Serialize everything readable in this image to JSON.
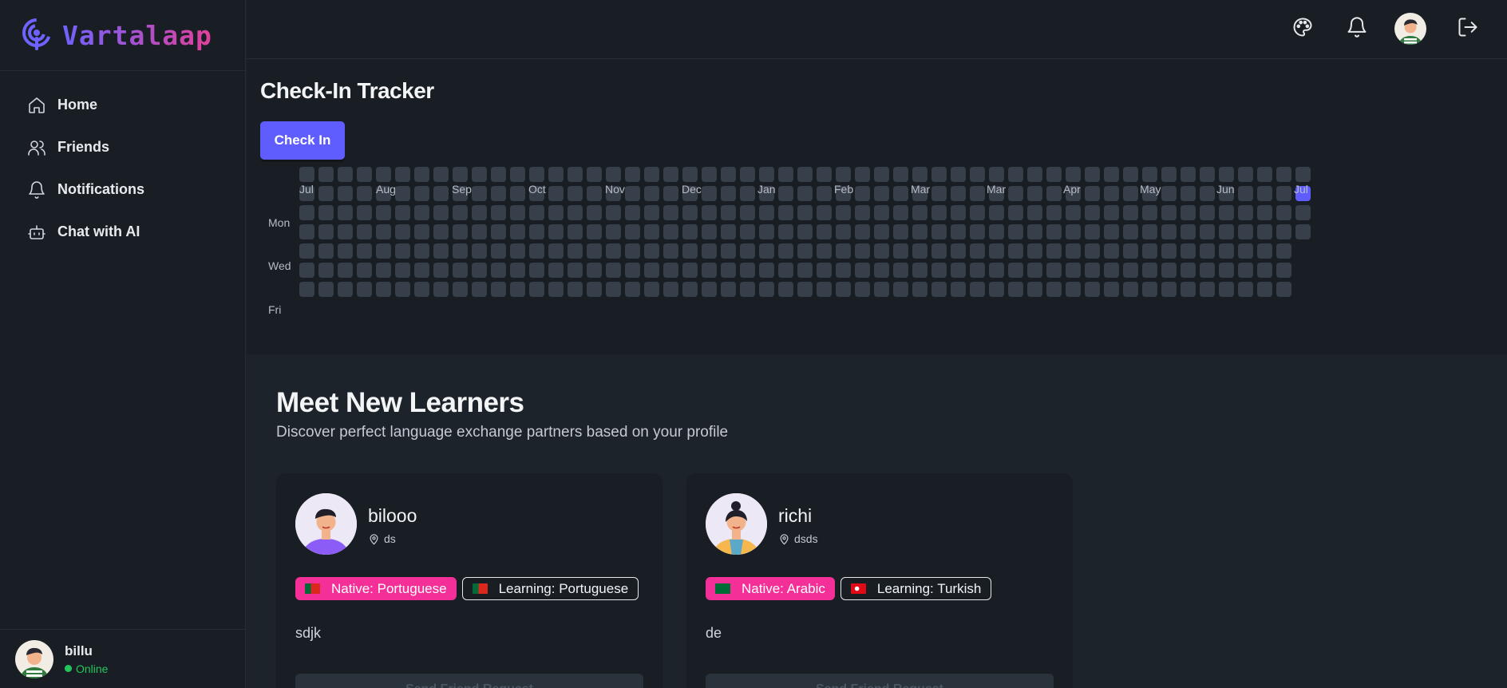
{
  "app": {
    "name": "Vartalaap"
  },
  "sidebar": {
    "items": [
      {
        "label": "Home",
        "icon": "home-icon"
      },
      {
        "label": "Friends",
        "icon": "users-icon"
      },
      {
        "label": "Notifications",
        "icon": "bell-icon"
      },
      {
        "label": "Chat with AI",
        "icon": "bot-icon"
      }
    ],
    "user": {
      "name": "billu",
      "status": "Online"
    }
  },
  "topbar": {
    "icons": [
      "palette-icon",
      "bell-icon",
      "avatar",
      "logout-icon"
    ]
  },
  "tracker": {
    "title": "Check-In Tracker",
    "button_label": "Check In",
    "months": [
      "Jul",
      "Aug",
      "Sep",
      "Oct",
      "Nov",
      "Dec",
      "Jan",
      "Feb",
      "Mar",
      "Mar",
      "Apr",
      "May",
      "Jun",
      "Jul"
    ],
    "day_labels": [
      "Mon",
      "Wed",
      "Fri"
    ],
    "checked_days": [
      {
        "week": 52,
        "day": 1
      },
      {
        "week": 53,
        "day": 0
      }
    ]
  },
  "main": {
    "title": "Meet New Learners",
    "subtitle": "Discover perfect language exchange partners based on your profile"
  },
  "learners": [
    {
      "name": "bilooo",
      "location": "ds",
      "native": "Native: Portuguese",
      "learning": "Learning: Portuguese",
      "bio": "sdjk",
      "button_label": "Send Friend Request"
    },
    {
      "name": "richi",
      "location": "dsds",
      "native": "Native: Arabic",
      "learning": "Learning: Turkish",
      "bio": "de",
      "button_label": "Send Friend Request"
    }
  ],
  "colors": {
    "accent": "#605dff",
    "native_badge": "#f43098",
    "online": "#22c55e",
    "cell_empty": "#373f4b"
  }
}
